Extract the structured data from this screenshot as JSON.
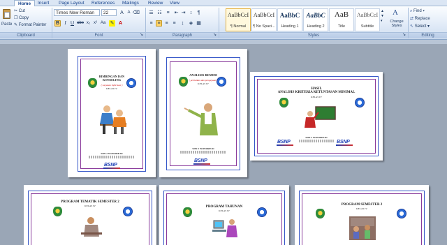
{
  "tabs": [
    "Home",
    "Insert",
    "Page Layout",
    "References",
    "Mailings",
    "Review",
    "View"
  ],
  "clipboard": {
    "paste": "Paste",
    "cut": "Cut",
    "copy": "Copy",
    "format_painter": "Format Painter",
    "label": "Clipboard"
  },
  "font": {
    "name": "Times New Roman",
    "size": "22",
    "label": "Font"
  },
  "paragraph": {
    "label": "Paragraph"
  },
  "styles": {
    "label": "Styles",
    "items": [
      {
        "preview": "AaBbCcI",
        "name": "¶ Normal"
      },
      {
        "preview": "AaBbCcI",
        "name": "¶ No Spaci..."
      },
      {
        "preview": "AaBbC",
        "name": "Heading 1"
      },
      {
        "preview": "AaBbC",
        "name": "Heading 2"
      },
      {
        "preview": "AaB",
        "name": "Title"
      },
      {
        "preview": "AaBbCcI",
        "name": "Subtitle"
      }
    ],
    "change_styles": "Change Styles"
  },
  "editing": {
    "find": "Find",
    "replace": "Replace",
    "select": "Select",
    "label": "Editing"
  },
  "pages": {
    "p1": {
      "title1": "BIMBINGAN DAN",
      "title2": "KONSELING",
      "sub": "( Layanan Informasi )",
      "kelas": "KELAS IV",
      "school": "SDN 2 WONOREJO",
      "bsnp": "BSNP"
    },
    "p2": {
      "title": "ANALISIS REMIDI",
      "sub": "( perbaikan dan pengayaan )",
      "kelas": "KELAS IV",
      "school": "SDN 2 WONOREJO",
      "bsnp": "BSNP"
    },
    "p3": {
      "title1": "HASIL",
      "title2": "ANALISIS KRITERIA KETUNTASAN MINIMAL",
      "kelas": "KELAS IV",
      "school": "SDN 2 WONOREJO",
      "bsnp": "BSNP"
    },
    "p4": {
      "title": "PROGRAM TEMATIK SEMESTER 2",
      "kelas": "KELAS IV"
    },
    "p5": {
      "title": "PROGRAM TAHUNAN",
      "kelas": "KELAS IV"
    },
    "p6": {
      "title": "PROGRAM SEMESTER 2",
      "kelas": "KELAS IV"
    }
  }
}
